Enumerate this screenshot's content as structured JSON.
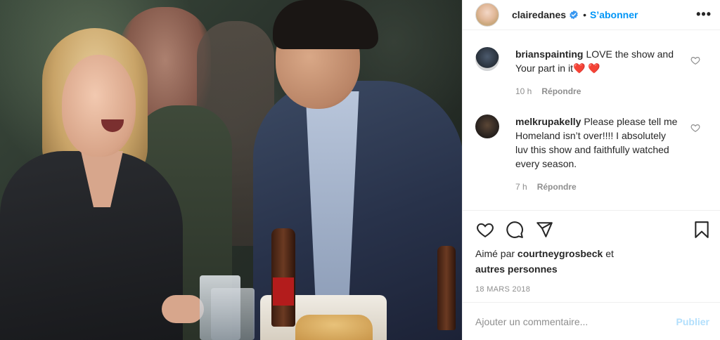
{
  "post": {
    "username": "clairedanes",
    "follow_label": "S’abonner",
    "separator": "•",
    "more_label": "•••"
  },
  "comments": [
    {
      "username": "brianspainting",
      "text": "LOVE the show and Your part in it❤️ ❤️",
      "time": "10 h",
      "reply_label": "Répondre"
    },
    {
      "username": "melkrupakelly",
      "text": "Please please tell me Homeland isn’t over!!!! I absolutely luv this show and faithfully watched every season.",
      "time": "7 h",
      "reply_label": "Répondre"
    }
  ],
  "likes": {
    "prefix": "Aimé par",
    "user": "courtneygrosbeck",
    "middle": "et",
    "others": "autres personnes"
  },
  "date": "18 MARS 2018",
  "add_comment": {
    "placeholder": "Ajouter un commentaire...",
    "post_label": "Publier"
  },
  "colors": {
    "accent": "#0095f6",
    "post_disabled": "#b2dffc",
    "muted": "#8e8e8e",
    "text": "#262626",
    "border": "#efefef"
  },
  "icons": {
    "header": [
      "verified-badge-icon",
      "more-options-icon"
    ],
    "comment": [
      "heart-icon"
    ],
    "actions": [
      "heart-icon",
      "comment-icon",
      "share-icon",
      "bookmark-icon"
    ]
  }
}
